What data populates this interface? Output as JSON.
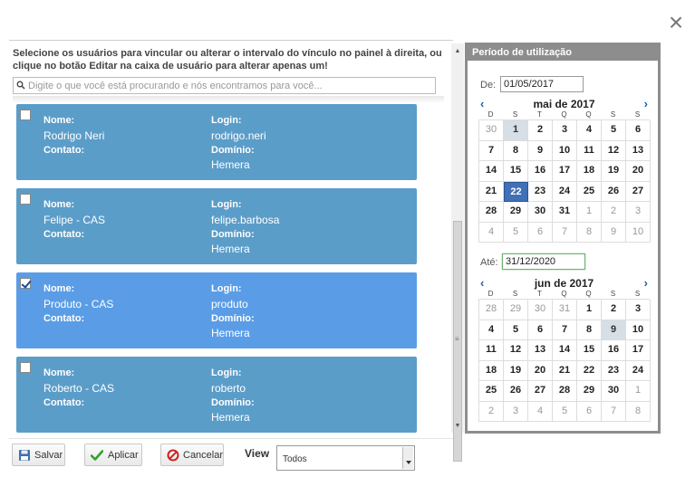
{
  "dialog": {
    "close_glyph": "×"
  },
  "instructions": "Selecione os usuários para vincular ou alterar o intervalo do vínculo no painel à direita, ou clique no botão Editar na caixa de usuário para alterar apenas um!",
  "search": {
    "placeholder": "Digite o que você está procurando e nós encontramos para você..."
  },
  "labels": {
    "nome": "Nome:",
    "contato": "Contato:",
    "login": "Login:",
    "dominio": "Domínio:"
  },
  "users": [
    {
      "checked": false,
      "nome": "Rodrigo Neri",
      "contato": "",
      "login": "rodrigo.neri",
      "dominio": "Hemera"
    },
    {
      "checked": false,
      "nome": "Felipe - CAS",
      "contato": "",
      "login": "felipe.barbosa",
      "dominio": "Hemera"
    },
    {
      "checked": true,
      "nome": "Produto - CAS",
      "contato": "",
      "login": "produto",
      "dominio": "Hemera"
    },
    {
      "checked": false,
      "nome": "Roberto - CAS",
      "contato": "",
      "login": "roberto",
      "dominio": "Hemera"
    }
  ],
  "period": {
    "title": "Período de utilização",
    "from_label": "De:",
    "from_value": "01/05/2017",
    "to_label": "Até:",
    "to_value": "31/12/2020",
    "weekdays": [
      "D",
      "S",
      "T",
      "Q",
      "Q",
      "S",
      "S"
    ],
    "calendars": [
      {
        "title": "mai de 2017",
        "prev": "‹",
        "next": "›",
        "days": [
          {
            "d": "30",
            "m": true
          },
          {
            "d": "1",
            "range": true
          },
          {
            "d": "2"
          },
          {
            "d": "3"
          },
          {
            "d": "4"
          },
          {
            "d": "5"
          },
          {
            "d": "6"
          },
          {
            "d": "7"
          },
          {
            "d": "8"
          },
          {
            "d": "9"
          },
          {
            "d": "10"
          },
          {
            "d": "11"
          },
          {
            "d": "12"
          },
          {
            "d": "13"
          },
          {
            "d": "14"
          },
          {
            "d": "15"
          },
          {
            "d": "16"
          },
          {
            "d": "17"
          },
          {
            "d": "18"
          },
          {
            "d": "19"
          },
          {
            "d": "20"
          },
          {
            "d": "21"
          },
          {
            "d": "22",
            "sel": true
          },
          {
            "d": "23"
          },
          {
            "d": "24"
          },
          {
            "d": "25"
          },
          {
            "d": "26"
          },
          {
            "d": "27"
          },
          {
            "d": "28"
          },
          {
            "d": "29"
          },
          {
            "d": "30"
          },
          {
            "d": "31"
          },
          {
            "d": "1",
            "m": true
          },
          {
            "d": "2",
            "m": true
          },
          {
            "d": "3",
            "m": true
          },
          {
            "d": "4",
            "m": true
          },
          {
            "d": "5",
            "m": true
          },
          {
            "d": "6",
            "m": true
          },
          {
            "d": "7",
            "m": true
          },
          {
            "d": "8",
            "m": true
          },
          {
            "d": "9",
            "m": true
          },
          {
            "d": "10",
            "m": true
          }
        ]
      },
      {
        "title": "jun de 2017",
        "prev": "‹",
        "next": "›",
        "days": [
          {
            "d": "28",
            "m": true
          },
          {
            "d": "29",
            "m": true
          },
          {
            "d": "30",
            "m": true
          },
          {
            "d": "31",
            "m": true
          },
          {
            "d": "1"
          },
          {
            "d": "2"
          },
          {
            "d": "3"
          },
          {
            "d": "4"
          },
          {
            "d": "5"
          },
          {
            "d": "6"
          },
          {
            "d": "7"
          },
          {
            "d": "8"
          },
          {
            "d": "9",
            "range": true
          },
          {
            "d": "10"
          },
          {
            "d": "11"
          },
          {
            "d": "12"
          },
          {
            "d": "13"
          },
          {
            "d": "14"
          },
          {
            "d": "15"
          },
          {
            "d": "16"
          },
          {
            "d": "17"
          },
          {
            "d": "18"
          },
          {
            "d": "19"
          },
          {
            "d": "20"
          },
          {
            "d": "21"
          },
          {
            "d": "22"
          },
          {
            "d": "23"
          },
          {
            "d": "24"
          },
          {
            "d": "25"
          },
          {
            "d": "26"
          },
          {
            "d": "27"
          },
          {
            "d": "28"
          },
          {
            "d": "29"
          },
          {
            "d": "30"
          },
          {
            "d": "1",
            "m": true
          },
          {
            "d": "2",
            "m": true
          },
          {
            "d": "3",
            "m": true
          },
          {
            "d": "4",
            "m": true
          },
          {
            "d": "5",
            "m": true
          },
          {
            "d": "6",
            "m": true
          },
          {
            "d": "7",
            "m": true
          },
          {
            "d": "8",
            "m": true
          }
        ]
      }
    ]
  },
  "footer": {
    "save_label": "Salvar",
    "apply_label": "Aplicar",
    "cancel_label": "Cancelar",
    "view_label": "View",
    "view_value": "Todos"
  },
  "colors": {
    "card": "#5b9dc9",
    "card_selected": "#5a9de6",
    "panel_border": "#8d8d8d",
    "selected_day": "#3f70b8"
  }
}
